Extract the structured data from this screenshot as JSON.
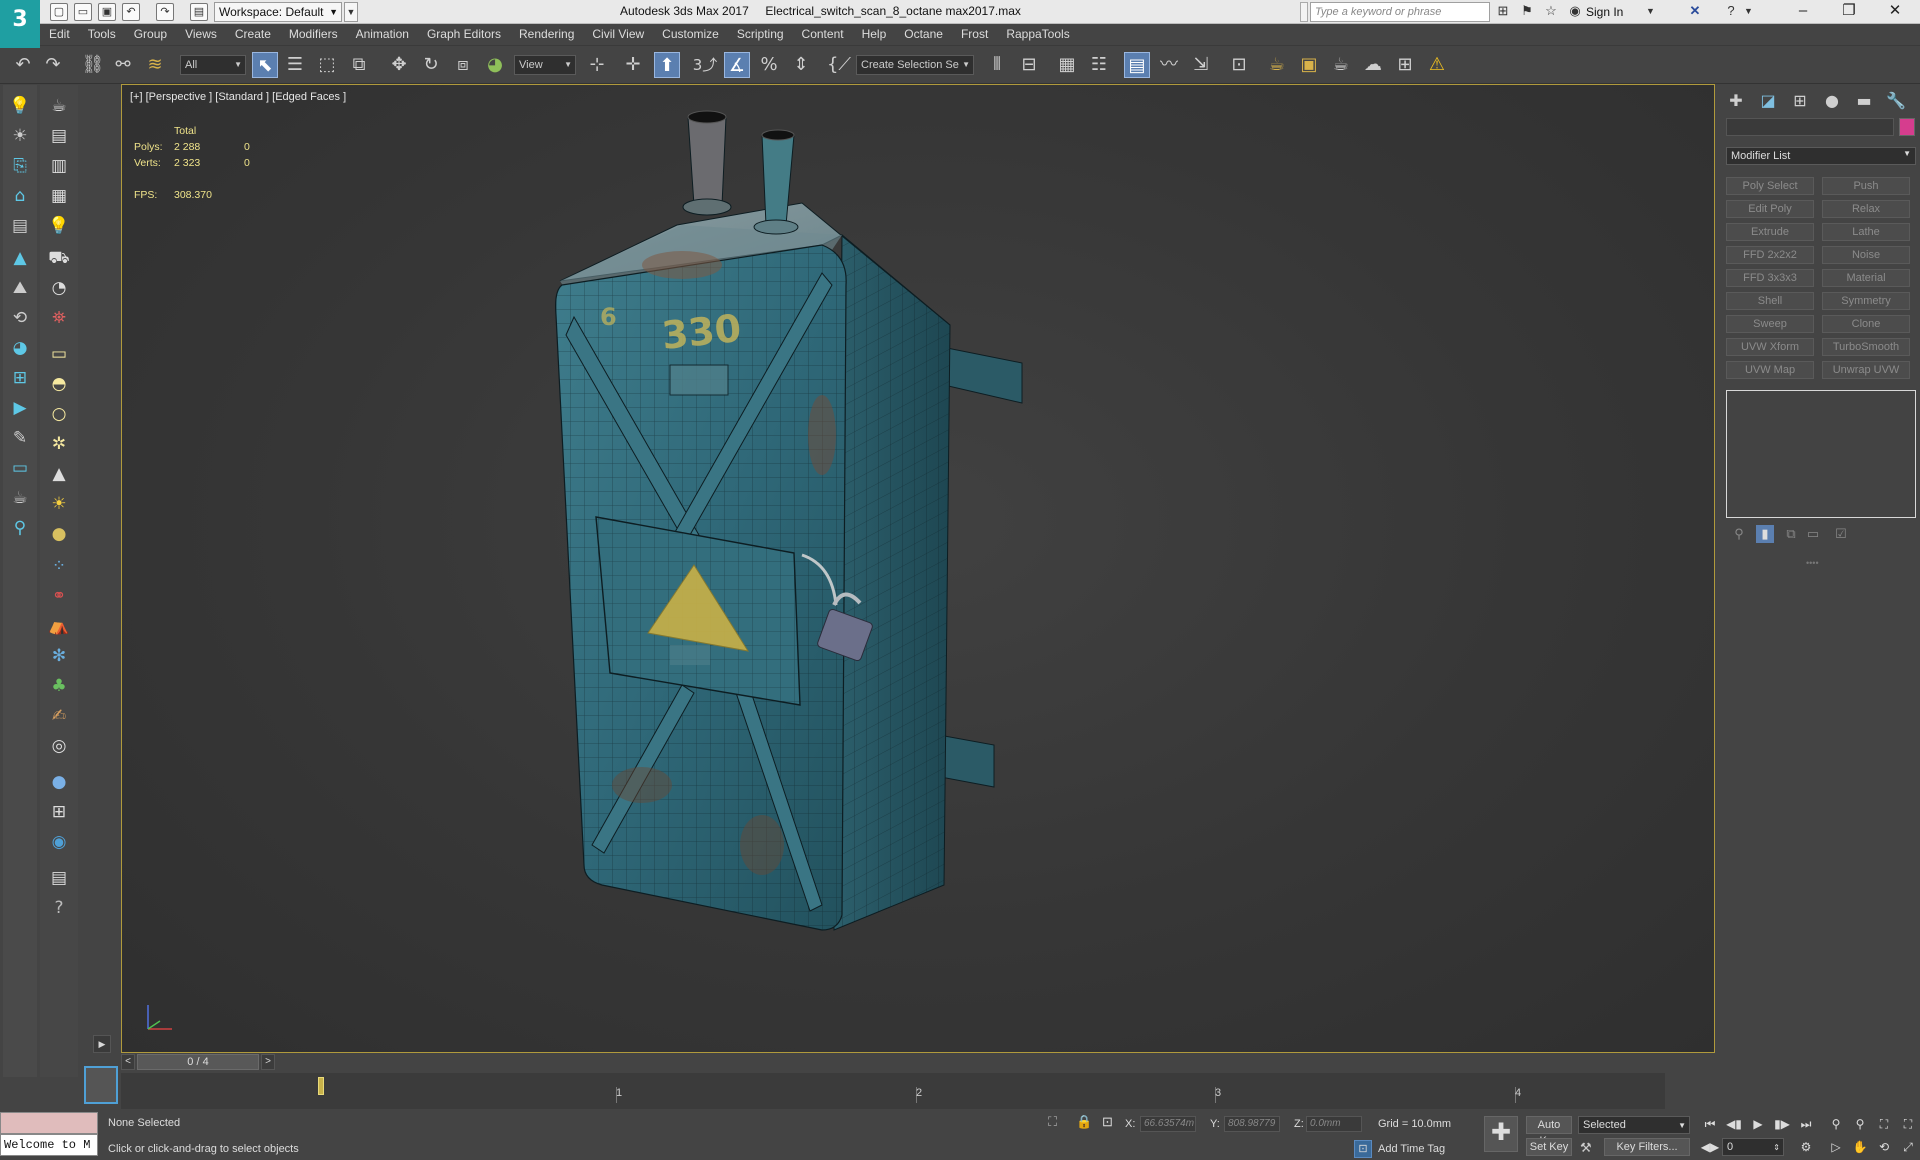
{
  "app": {
    "title_text": "Autodesk 3ds Max 2017     Electrical_switch_scan_8_octane max2017.max",
    "logo_text": "3",
    "workspace_label": "Workspace: Default",
    "search_placeholder": "Type a keyword or phrase",
    "sign_in_label": "Sign In"
  },
  "menu": [
    "Edit",
    "Tools",
    "Group",
    "Views",
    "Create",
    "Modifiers",
    "Animation",
    "Graph Editors",
    "Rendering",
    "Civil View",
    "Customize",
    "Scripting",
    "Content",
    "Help",
    "Octane",
    "Frost",
    "RappaTools"
  ],
  "toolbar": {
    "filter_value": "All",
    "ref_coord_value": "View",
    "selection_set_placeholder": "Create Selection Se",
    "snap_value": "3"
  },
  "viewport": {
    "label": "[+] [Perspective ] [Standard ] [Edged Faces ]",
    "stats": {
      "total_label": "Total",
      "polys_label": "Polys:",
      "polys_total": "2 288",
      "polys_selected": "0",
      "verts_label": "Verts:",
      "verts_total": "2 323",
      "verts_selected": "0",
      "fps_label": "FPS:",
      "fps_value": "308.370"
    },
    "model_text_330": "330",
    "model_text_6": "6"
  },
  "command_panel": {
    "modifier_list_label": "Modifier List",
    "accent_color": "#d63d8e",
    "modifier_buttons": [
      [
        "Poly Select",
        "Push"
      ],
      [
        "Edit Poly",
        "Relax"
      ],
      [
        "Extrude",
        "Lathe"
      ],
      [
        "FFD 2x2x2",
        "Noise"
      ],
      [
        "FFD 3x3x3",
        "Material"
      ],
      [
        "Shell",
        "Symmetry"
      ],
      [
        "Sweep",
        "Clone"
      ],
      [
        "UVW Xform",
        "TurboSmooth"
      ],
      [
        "UVW Map",
        "Unwrap UVW"
      ]
    ]
  },
  "timeline": {
    "slider_label": "0 / 4",
    "ticks": [
      "1",
      "2",
      "3",
      "4"
    ]
  },
  "status": {
    "listener_text": "Welcome to M",
    "selection": "None Selected",
    "prompt": "Click or click-and-drag to select objects",
    "x_label": "X:",
    "x_value": "66.63574m",
    "y_label": "Y:",
    "y_value": "808.98779",
    "z_label": "Z:",
    "z_value": "0.0mm",
    "grid": "Grid = 10.0mm",
    "add_time_tag": "Add Time Tag",
    "auto_key": "Auto Key",
    "set_key": "Set Key",
    "selected_dropdown": "Selected",
    "key_filters": "Key Filters...",
    "frame_value": "0"
  }
}
